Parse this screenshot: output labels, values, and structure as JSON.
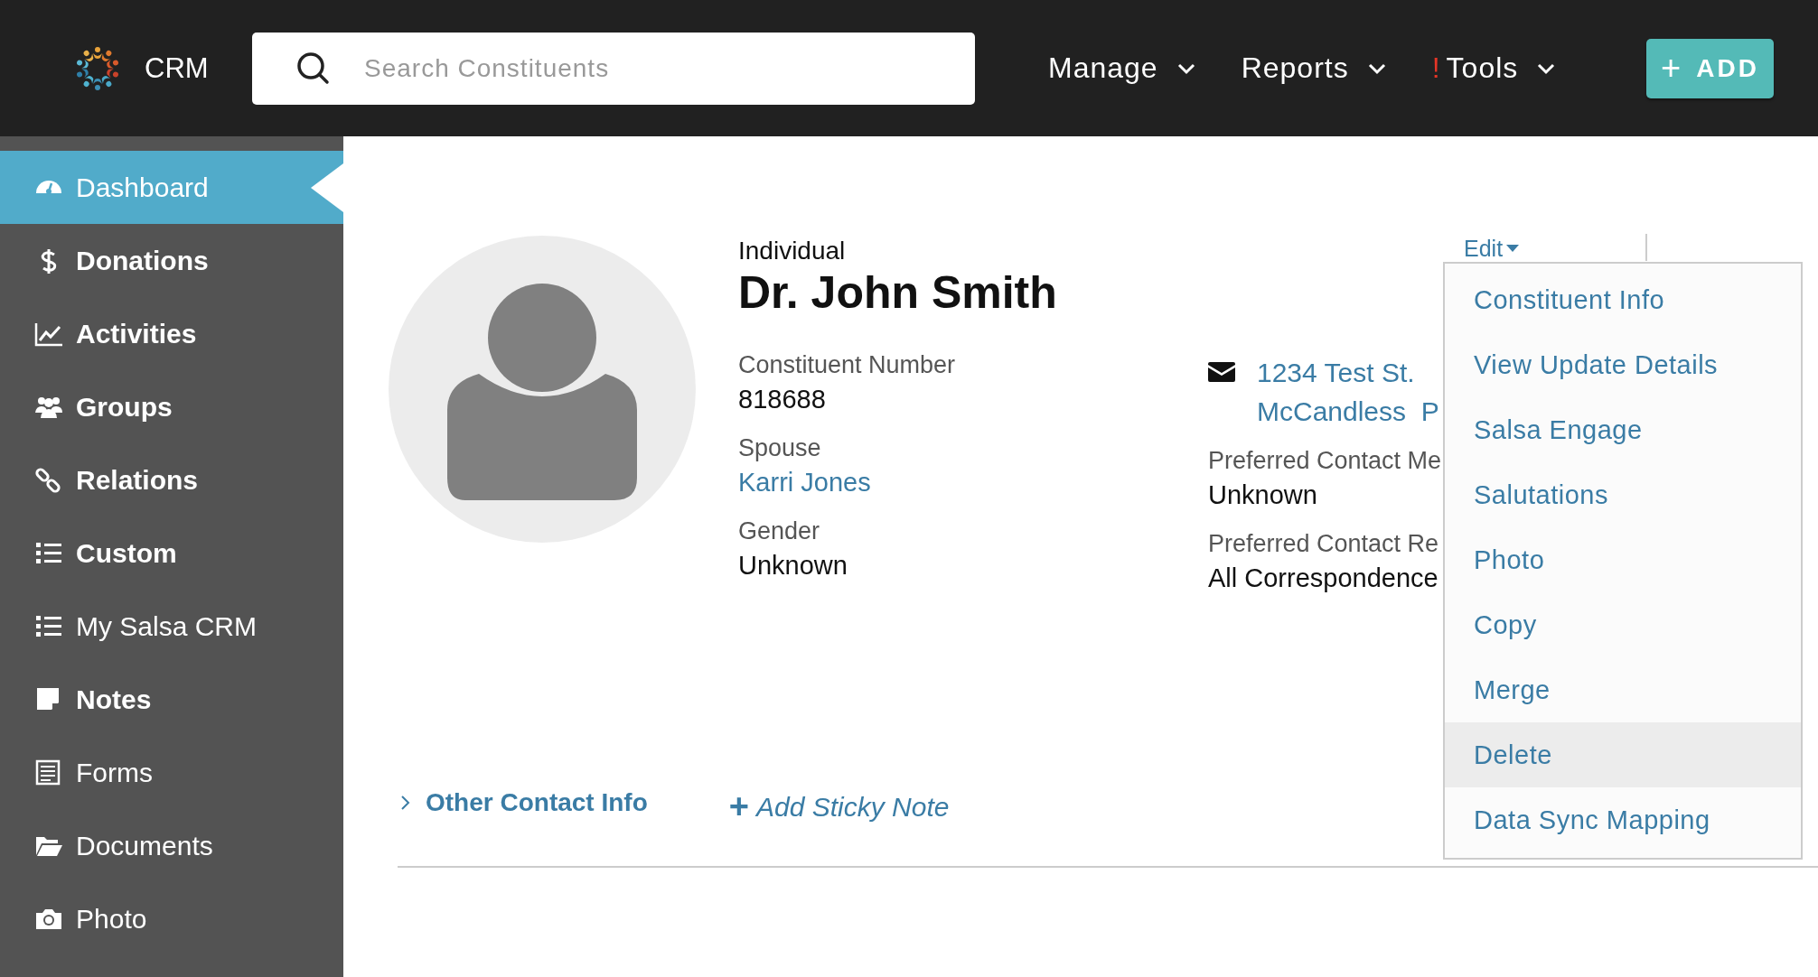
{
  "header": {
    "logo_text": "CRM",
    "search": {
      "placeholder": "Search Constituents"
    },
    "nav": [
      {
        "label": "Manage"
      },
      {
        "label": "Reports"
      },
      {
        "label": "Tools",
        "badge": "!"
      }
    ],
    "add_button": {
      "icon": "+",
      "label": "ADD"
    }
  },
  "sidebar": {
    "items": [
      {
        "label": "Dashboard",
        "selected": true,
        "bold": false
      },
      {
        "label": "Donations",
        "selected": false,
        "bold": true
      },
      {
        "label": "Activities",
        "selected": false,
        "bold": true
      },
      {
        "label": "Groups",
        "selected": false,
        "bold": true
      },
      {
        "label": "Relations",
        "selected": false,
        "bold": true
      },
      {
        "label": "Custom",
        "selected": false,
        "bold": true
      },
      {
        "label": "My Salsa CRM",
        "selected": false,
        "bold": false
      },
      {
        "label": "Notes",
        "selected": false,
        "bold": true
      },
      {
        "label": "Forms",
        "selected": false,
        "bold": false
      },
      {
        "label": "Documents",
        "selected": false,
        "bold": false
      },
      {
        "label": "Photo",
        "selected": false,
        "bold": false
      }
    ]
  },
  "profile": {
    "type": "Individual",
    "name": "Dr. John Smith",
    "fields": [
      {
        "label": "Constituent Number",
        "value": "818688",
        "link": false
      },
      {
        "label": "Spouse",
        "value": "Karri Jones",
        "link": true
      },
      {
        "label": "Gender",
        "value": "Unknown",
        "link": false
      }
    ],
    "address": [
      "1234 Test St.",
      "McCandless  P"
    ],
    "contact_fields": [
      {
        "label": "Preferred Contact Me",
        "value": "Unknown"
      },
      {
        "label": "Preferred Contact Re",
        "value": "All Correspondence"
      }
    ],
    "edit": "Edit",
    "other_contact_info": "Other Contact Info",
    "add_sticky_note": {
      "icon": "+",
      "label": "Add Sticky Note"
    }
  },
  "edit_menu": {
    "items": [
      {
        "label": "Constituent Info",
        "selected": false
      },
      {
        "label": "View Update Details",
        "selected": false
      },
      {
        "label": "Salsa Engage",
        "selected": false
      },
      {
        "label": "Salutations",
        "selected": false
      },
      {
        "label": "Photo",
        "selected": false
      },
      {
        "label": "Copy",
        "selected": false
      },
      {
        "label": "Merge",
        "selected": false
      },
      {
        "label": "Delete",
        "selected": true
      },
      {
        "label": "Data Sync Mapping",
        "selected": false
      }
    ]
  }
}
